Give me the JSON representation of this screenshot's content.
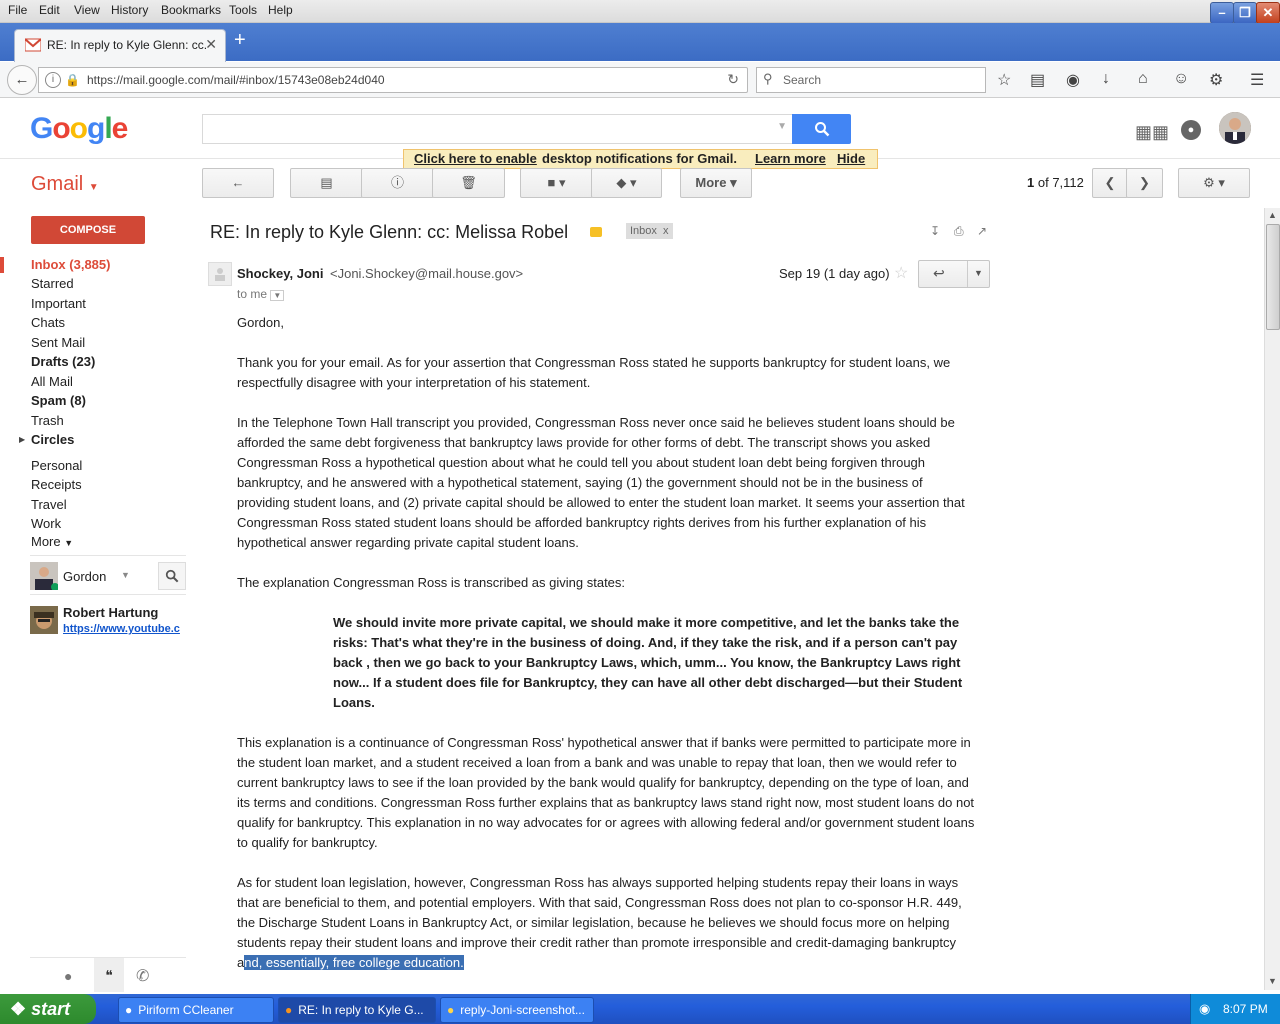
{
  "browser": {
    "menu": [
      "File",
      "Edit",
      "View",
      "History",
      "Bookmarks",
      "Tools",
      "Help"
    ],
    "tab_title": "RE: In reply to Kyle Glenn: cc...",
    "url": "https://mail.google.com/mail/#inbox/15743e08eb24d040",
    "search_placeholder": "Search"
  },
  "gmail": {
    "logo": "Google",
    "brand": "Gmail",
    "notification": {
      "link1": "Click here to enable",
      "text": " desktop notifications for Gmail.",
      "link2": "Learn more",
      "hide": "Hide"
    },
    "toolbar": {
      "more": "More"
    },
    "pager": {
      "current": "1",
      "of": "of 7,112"
    },
    "compose": "COMPOSE",
    "nav": {
      "inbox": "Inbox (3,885)",
      "starred": "Starred",
      "important": "Important",
      "chats": "Chats",
      "sent": "Sent Mail",
      "drafts": "Drafts (23)",
      "all": "All Mail",
      "spam": "Spam (8)",
      "trash": "Trash",
      "circles": "Circles",
      "personal": "Personal",
      "receipts": "Receipts",
      "travel": "Travel",
      "work": "Work",
      "more": "More"
    },
    "chat": {
      "self": "Gordon",
      "contact_name": "Robert Hartung",
      "contact_status": "https://www.youtube.c"
    }
  },
  "message": {
    "subject": "RE: In reply to Kyle Glenn: cc: Melissa Robel",
    "label": "Inbox",
    "sender_name": "Shockey, Joni",
    "sender_email": "<Joni.Shockey@mail.house.gov>",
    "to": "to me",
    "date": "Sep 19 (1 day ago)",
    "greeting": "Gordon,",
    "p1": "Thank you for your email. As for your assertion that Congressman Ross stated he supports bankruptcy for student loans, we respectfully disagree with your interpretation of his statement.",
    "p2": "In the Telephone Town Hall transcript you provided, Congressman Ross never once said he believes student loans should be afforded the same debt forgiveness that bankruptcy laws provide for other forms of debt. The transcript shows you asked Congressman Ross a hypothetical question about what he could tell you about student loan debt being forgiven through bankruptcy, and he answered with a hypothetical statement, saying (1) the government should not be in the business of providing student loans, and (2) private capital should be allowed to enter the student loan market. It seems your assertion that Congressman Ross stated student loans should be afforded bankruptcy rights derives from his further explanation of his hypothetical answer regarding private capital student loans.",
    "p3": "The explanation Congressman Ross is transcribed as giving states:",
    "quote": "We should invite more private capital, we should make it more competitive, and let the banks take the risks: That's what they're in the business of doing. And, if they take the risk, and if a person can't pay back , then we go back to your Bankruptcy Laws, which, umm... You know, the Bankruptcy Laws right now... If a student does file for Bankruptcy, they can have all other debt discharged—but their Student Loans.",
    "p4": "This explanation is a continuance of Congressman Ross' hypothetical answer that if banks were permitted to participate more in the student loan market, and a student received a loan from a bank and was unable to repay that loan, then we would refer to current bankruptcy laws to see if the loan provided by the bank would qualify for bankruptcy, depending on the type of loan, and its terms and conditions. Congressman Ross further explains that as bankruptcy laws stand right now, most student loans do not qualify for bankruptcy. This explanation in no way advocates for or agrees with allowing federal and/or government student loans to qualify for bankruptcy.",
    "p5": "As for student loan legislation, however, Congressman Ross has always supported helping students repay their loans in ways that are beneficial to them, and potential employers. With that said, Congressman Ross does not plan to co-sponsor H.R. 449, the Discharge Student Loans in Bankruptcy Act, or similar legislation, because he believes we should focus more on helping students repay their student loans and improve their credit rather than promote irresponsible and credit-damaging bankruptcy a",
    "p5_highlight": "nd, essentially, free college education."
  },
  "taskbar": {
    "start": "start",
    "tasks": [
      "Piriform CCleaner",
      "RE: In reply to Kyle G...",
      "reply-Joni-screenshot..."
    ],
    "clock": "8:07 PM"
  },
  "colors": {
    "gmail_red": "#dd4b39",
    "compose": "#d14836",
    "search_blue": "#4285f4",
    "highlight": "#3b6fb3"
  }
}
